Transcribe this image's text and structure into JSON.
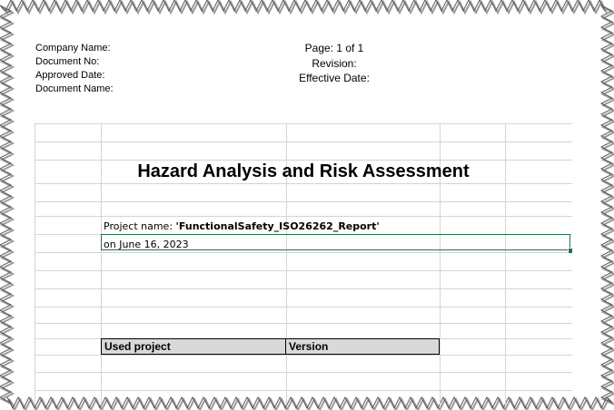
{
  "header": {
    "left": {
      "company_name": "Company Name:",
      "document_no": "Document No:",
      "approved_date": "Approved Date:",
      "document_name": "Document Name:"
    },
    "center": {
      "page": "Page: 1 of 1",
      "revision": "Revision:",
      "effective_date": "Effective Date:"
    }
  },
  "sheet": {
    "title": "Hazard Analysis and Risk Assessment",
    "project_label": "Project name: ",
    "project_name": "'FunctionalSafety_ISO26262_Report'",
    "date_line": "on June 16, 2023",
    "table_headers": {
      "used_project": "Used project",
      "version": "Version"
    }
  },
  "colors": {
    "selection": "#217346",
    "gridline": "#d4d4d4",
    "header_fill": "#d9d9d9"
  }
}
